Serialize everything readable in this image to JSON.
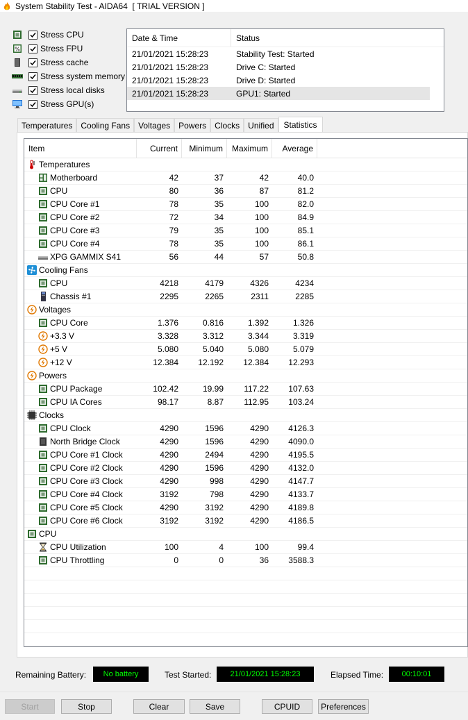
{
  "window": {
    "title": "System Stability Test - AIDA64  [ TRIAL VERSION ]"
  },
  "stress_options": [
    {
      "label": "Stress CPU",
      "checked": true,
      "icon": "cpu-chip-icon"
    },
    {
      "label": "Stress FPU",
      "checked": true,
      "icon": "percent-icon"
    },
    {
      "label": "Stress cache",
      "checked": true,
      "icon": "cache-icon"
    },
    {
      "label": "Stress system memory",
      "checked": true,
      "icon": "memory-icon"
    },
    {
      "label": "Stress local disks",
      "checked": true,
      "icon": "disk-icon"
    },
    {
      "label": "Stress GPU(s)",
      "checked": true,
      "icon": "monitor-icon"
    }
  ],
  "log": {
    "headers": {
      "datetime": "Date & Time",
      "status": "Status"
    },
    "rows": [
      {
        "datetime": "21/01/2021 15:28:23",
        "status": "Stability Test: Started"
      },
      {
        "datetime": "21/01/2021 15:28:23",
        "status": "Drive C: Started"
      },
      {
        "datetime": "21/01/2021 15:28:23",
        "status": "Drive D: Started"
      },
      {
        "datetime": "21/01/2021 15:28:23",
        "status": "GPU1: Started"
      }
    ]
  },
  "tabs": [
    {
      "label": "Temperatures"
    },
    {
      "label": "Cooling Fans"
    },
    {
      "label": "Voltages"
    },
    {
      "label": "Powers"
    },
    {
      "label": "Clocks"
    },
    {
      "label": "Unified"
    },
    {
      "label": "Statistics",
      "active": true
    }
  ],
  "stats": {
    "headers": {
      "item": "Item",
      "current": "Current",
      "minimum": "Minimum",
      "maximum": "Maximum",
      "average": "Average"
    },
    "rows": [
      {
        "type": "group",
        "label": "Temperatures",
        "icon": "thermometer-icon"
      },
      {
        "label": "Motherboard",
        "icon": "motherboard-icon",
        "cur": "42",
        "min": "37",
        "max": "42",
        "avg": "40.0"
      },
      {
        "label": "CPU",
        "icon": "cpu-chip-icon",
        "cur": "80",
        "min": "36",
        "max": "87",
        "avg": "81.2"
      },
      {
        "label": "CPU Core #1",
        "icon": "cpu-chip-icon",
        "cur": "78",
        "min": "35",
        "max": "100",
        "avg": "82.0"
      },
      {
        "label": "CPU Core #2",
        "icon": "cpu-chip-icon",
        "cur": "72",
        "min": "34",
        "max": "100",
        "avg": "84.9"
      },
      {
        "label": "CPU Core #3",
        "icon": "cpu-chip-icon",
        "cur": "79",
        "min": "35",
        "max": "100",
        "avg": "85.1"
      },
      {
        "label": "CPU Core #4",
        "icon": "cpu-chip-icon",
        "cur": "78",
        "min": "35",
        "max": "100",
        "avg": "86.1"
      },
      {
        "label": "XPG GAMMIX S41",
        "icon": "drive-icon",
        "cur": "56",
        "min": "44",
        "max": "57",
        "avg": "50.8"
      },
      {
        "type": "group",
        "label": "Cooling Fans",
        "icon": "fan-icon"
      },
      {
        "label": "CPU",
        "icon": "cpu-chip-icon",
        "cur": "4218",
        "min": "4179",
        "max": "4326",
        "avg": "4234"
      },
      {
        "label": "Chassis #1",
        "icon": "chassis-icon",
        "cur": "2295",
        "min": "2265",
        "max": "2311",
        "avg": "2285"
      },
      {
        "type": "group",
        "label": "Voltages",
        "icon": "voltage-icon"
      },
      {
        "label": "CPU Core",
        "icon": "cpu-chip-icon",
        "cur": "1.376",
        "min": "0.816",
        "max": "1.392",
        "avg": "1.326"
      },
      {
        "label": "+3.3 V",
        "icon": "voltage-icon",
        "cur": "3.328",
        "min": "3.312",
        "max": "3.344",
        "avg": "3.319"
      },
      {
        "label": "+5 V",
        "icon": "voltage-icon",
        "cur": "5.080",
        "min": "5.040",
        "max": "5.080",
        "avg": "5.079"
      },
      {
        "label": "+12 V",
        "icon": "voltage-icon",
        "cur": "12.384",
        "min": "12.192",
        "max": "12.384",
        "avg": "12.293"
      },
      {
        "type": "group",
        "label": "Powers",
        "icon": "voltage-icon"
      },
      {
        "label": "CPU Package",
        "icon": "cpu-chip-icon",
        "cur": "102.42",
        "min": "19.99",
        "max": "117.22",
        "avg": "107.63"
      },
      {
        "label": "CPU IA Cores",
        "icon": "cpu-chip-icon",
        "cur": "98.17",
        "min": "8.87",
        "max": "112.95",
        "avg": "103.24"
      },
      {
        "type": "group",
        "label": "Clocks",
        "icon": "clock-chip-icon"
      },
      {
        "label": "CPU Clock",
        "icon": "cpu-chip-icon",
        "cur": "4290",
        "min": "1596",
        "max": "4290",
        "avg": "4126.3"
      },
      {
        "label": "North Bridge Clock",
        "icon": "chip-dark-icon",
        "cur": "4290",
        "min": "1596",
        "max": "4290",
        "avg": "4090.0"
      },
      {
        "label": "CPU Core #1 Clock",
        "icon": "cpu-chip-icon",
        "cur": "4290",
        "min": "2494",
        "max": "4290",
        "avg": "4195.5"
      },
      {
        "label": "CPU Core #2 Clock",
        "icon": "cpu-chip-icon",
        "cur": "4290",
        "min": "1596",
        "max": "4290",
        "avg": "4132.0"
      },
      {
        "label": "CPU Core #3 Clock",
        "icon": "cpu-chip-icon",
        "cur": "4290",
        "min": "998",
        "max": "4290",
        "avg": "4147.7"
      },
      {
        "label": "CPU Core #4 Clock",
        "icon": "cpu-chip-icon",
        "cur": "3192",
        "min": "798",
        "max": "4290",
        "avg": "4133.7"
      },
      {
        "label": "CPU Core #5 Clock",
        "icon": "cpu-chip-icon",
        "cur": "4290",
        "min": "3192",
        "max": "4290",
        "avg": "4189.8"
      },
      {
        "label": "CPU Core #6 Clock",
        "icon": "cpu-chip-icon",
        "cur": "3192",
        "min": "3192",
        "max": "4290",
        "avg": "4186.5"
      },
      {
        "type": "group",
        "label": "CPU",
        "icon": "cpu-chip-icon"
      },
      {
        "label": "CPU Utilization",
        "icon": "hourglass-icon",
        "cur": "100",
        "min": "4",
        "max": "100",
        "avg": "99.4"
      },
      {
        "label": "CPU Throttling",
        "icon": "cpu-chip-icon",
        "cur": "0",
        "min": "0",
        "max": "36",
        "avg": "3588.3"
      }
    ]
  },
  "status": {
    "battery_label": "Remaining Battery:",
    "battery_value": "No battery",
    "started_label": "Test Started:",
    "started_value": "21/01/2021 15:28:23",
    "elapsed_label": "Elapsed Time:",
    "elapsed_value": "00:10:01"
  },
  "buttons": {
    "start": "Start",
    "stop": "Stop",
    "clear": "Clear",
    "save": "Save",
    "cpuid": "CPUID",
    "preferences": "Preferences"
  },
  "colors": {
    "status_value_bg": "#000000",
    "status_value_fg": "#00ff00",
    "accent_blue": "#1e90ff",
    "chip_green": "#2e6b2e"
  }
}
